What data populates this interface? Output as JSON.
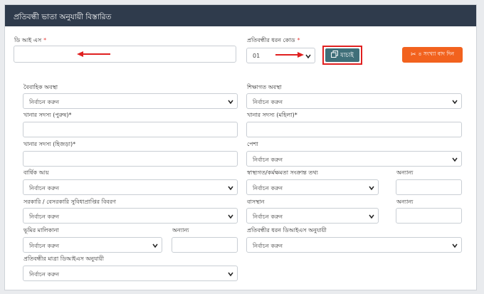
{
  "panel": {
    "title": "প্রতিবন্ধী ভাতা অনুযায়ী বিস্তারিত"
  },
  "placeholder_select": "নির্বাচন করুন",
  "fields": {
    "dis_label": "ডি আই এস",
    "required_mark": "*",
    "disability_type_label": "প্রতিবন্ধীর ধরন কোড",
    "disability_type_value": "01",
    "marital_label": "বৈবাহিক অবস্থা",
    "education_label": "শিক্ষাগত অবস্থা",
    "household_male_label": "খানার সদস্য (পুরুষ)*",
    "household_female_label": "খানার সদস্য (মহিলা)*",
    "household_hijra_label": "খানার সদস্য (হিজড়া)*",
    "occupation_label": "পেশা",
    "annual_income_label": "বার্ষিক আয়",
    "health_label": "স্বাস্থ্যগত/কর্মক্ষমতা সংক্রান্ত তথ্য",
    "other_label": "অন্যান্য",
    "govt_benefit_label": "সরকারি / বেসরকারি সুবিধাপ্রাপ্তির বিবরণ",
    "housing_label": "বাসস্থান",
    "land_label": "ভূমির মালিকানা",
    "type_dis_label": "প্রতিবন্ধীর ধরন ডিআইএস অনুযায়ী",
    "degree_dis_label": "প্রতিবন্ধীর মাত্রা ডিআইএস অনুযায়ী"
  },
  "buttons": {
    "check": "যাচাই",
    "reset": "৪ সংখ্যা বাদ দিন"
  },
  "colors": {
    "header_bg": "#2f3b4c",
    "check_btn": "#3f6f79",
    "reset_btn": "#f2621e",
    "highlight": "#e02020",
    "required": "#e53935"
  },
  "icons": {
    "check": "copy-icon",
    "reset": "scissors-icon",
    "dropdown": "chevron-down-icon",
    "annotation": "red-arrow-icon"
  }
}
